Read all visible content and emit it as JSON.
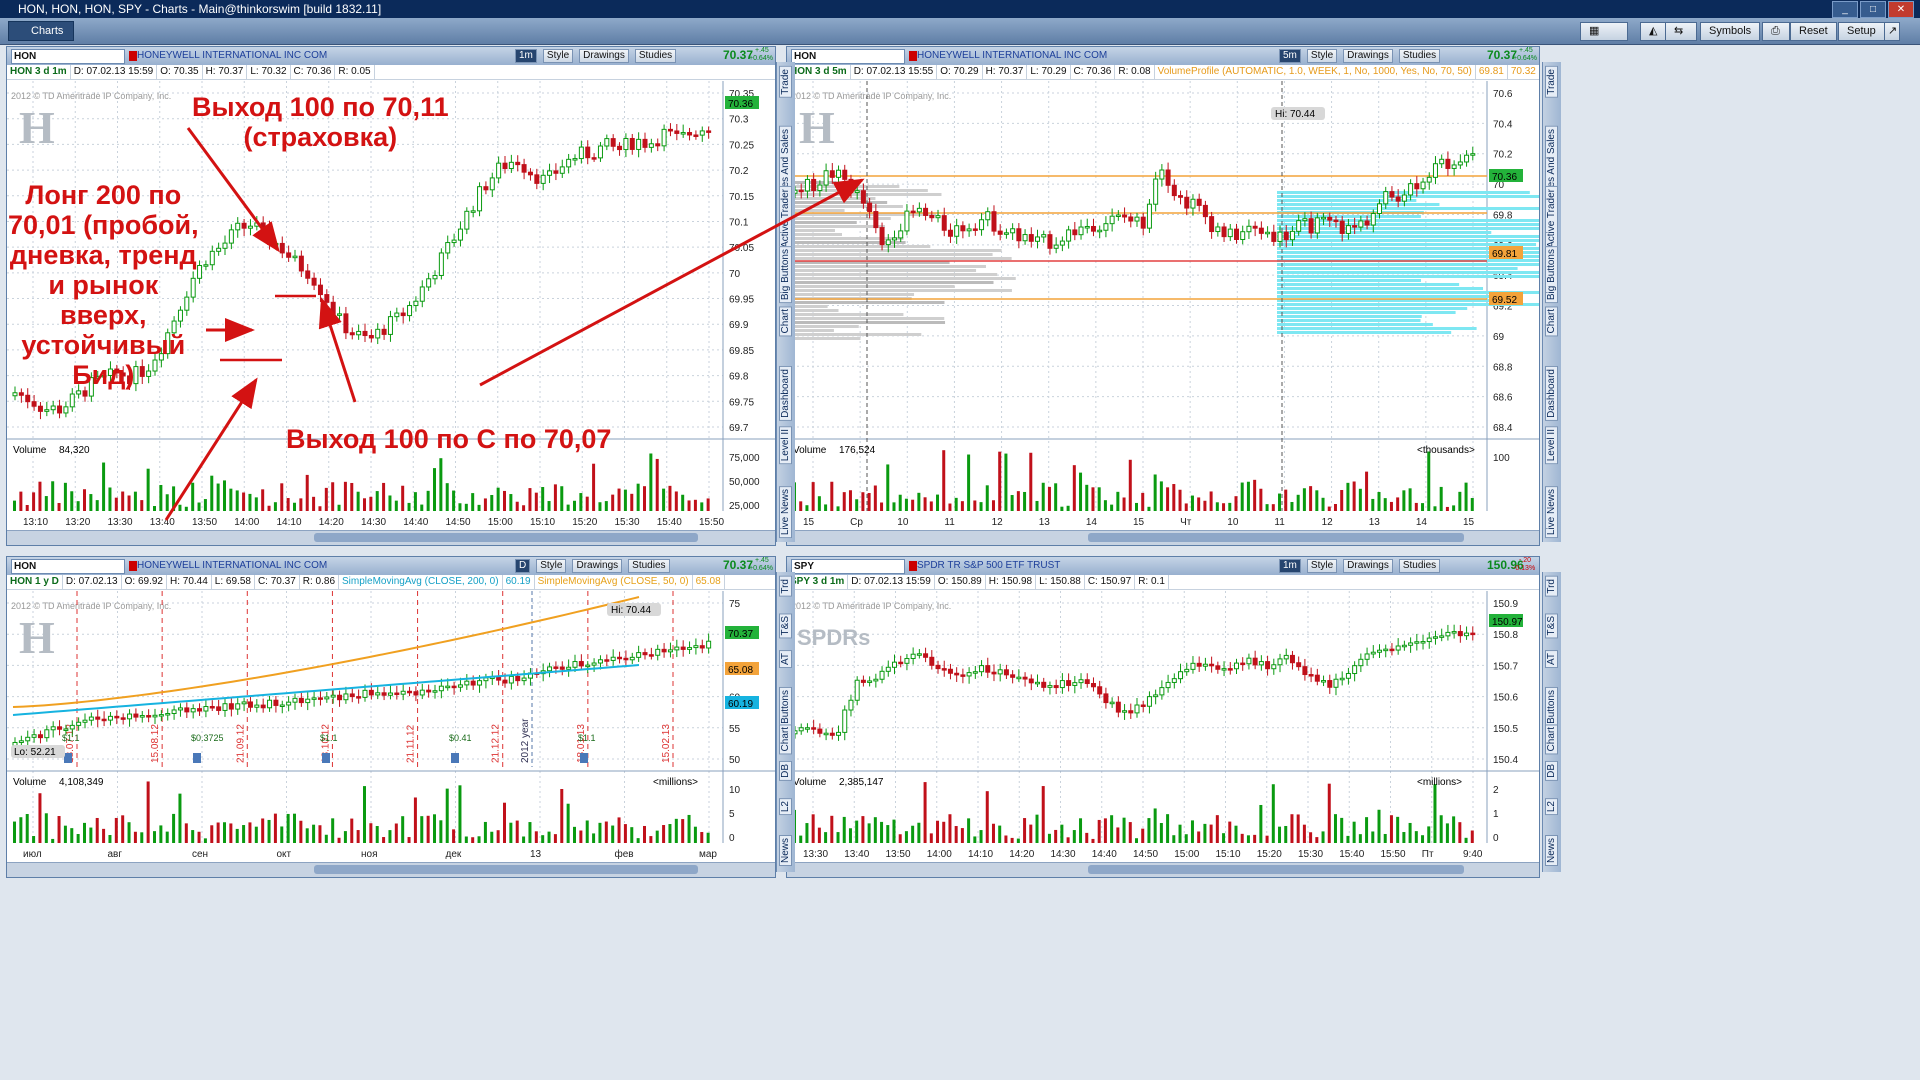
{
  "window": {
    "title": "HON, HON, HON, SPY - Charts -  Main@thinkorswim [build 1832.11]"
  },
  "toolbar": {
    "tab": "Charts",
    "symbols": "Symbols",
    "reset": "Reset",
    "setup": "Setup"
  },
  "sidebar_right": [
    "Trade",
    "Times And Sales",
    "Active Trader",
    "Big Buttons",
    "Chart",
    "Dashboard",
    "Level II",
    "Live News"
  ],
  "sidebar_right_small": [
    "Trd",
    "T&S",
    "AT",
    "Buttons",
    "Chart",
    "DB",
    "L2",
    "News"
  ],
  "panels": [
    {
      "symbol": "HON",
      "company": "HONEYWELL INTERNATIONAL INC COM",
      "interval": "1m",
      "last": "70.37",
      "change": "+.45",
      "change_pct": "+0.64%",
      "ohlc": [
        "HON 3 d 1m",
        "D: 07.02.13 15:59",
        "O: 70.35",
        "H: 70.37",
        "L: 70.32",
        "C: 70.36",
        "R: 0.05"
      ],
      "copyright": "2012 © TD Ameritrade IP Company, Inc.",
      "y_ticks": [
        "70.35",
        "70.3",
        "70.25",
        "70.2",
        "70.15",
        "70.1",
        "70.05",
        "70",
        "69.95",
        "69.9",
        "69.85",
        "69.8",
        "69.75",
        "69.7"
      ],
      "price_tag": "70.36",
      "volume": {
        "label": "Volume",
        "value": "84,320",
        "ticks": [
          "75,000",
          "50,000",
          "25,000"
        ]
      },
      "x_ticks": [
        "13:10",
        "13:20",
        "13:30",
        "13:40",
        "13:50",
        "14:00",
        "14:10",
        "14:20",
        "14:30",
        "14:40",
        "14:50",
        "15:00",
        "15:10",
        "15:20",
        "15:30",
        "15:40",
        "15:50"
      ],
      "annotations": {
        "exit1": "Выход 100 по 70,11\n(страховка)",
        "long": "Лонг 200 по\n70,01 (пробой,\nдневка, тренд\nи рынок\nвверх,\nустойчивый\nБид)",
        "exit2": "Выход 100 по С по 70,07"
      }
    },
    {
      "symbol": "HON",
      "company": "HONEYWELL INTERNATIONAL INC COM",
      "interval": "5m",
      "last": "70.37",
      "change": "+.45",
      "change_pct": "+0.64%",
      "ohlc": [
        "HON 3 d 5m",
        "D: 07.02.13 15:55",
        "O: 70.29",
        "H: 70.37",
        "L: 70.29",
        "C: 70.36",
        "R: 0.08"
      ],
      "study": "VolumeProfile (AUTOMATIC, 1.0, WEEK, 1, No, 1000, Yes, No, 70, 50)",
      "study_vals": [
        "69.81",
        "70.32",
        "69.52",
        "Vol..."
      ],
      "copyright": "2012 © TD Ameritrade IP Company, Inc.",
      "y_ticks": [
        "70.6",
        "70.4",
        "70.2",
        "70",
        "69.8",
        "69.6",
        "69.4",
        "69.2",
        "69",
        "68.8",
        "68.6",
        "68.4"
      ],
      "hi_label": "Hi: 70.44",
      "tags": [
        "70.36",
        "69.81",
        "69.52"
      ],
      "volume": {
        "label": "Volume",
        "value": "176,524",
        "unit": "<thousands>",
        "ticks": [
          "100"
        ]
      },
      "x_ticks": [
        "15",
        "Ср",
        "10",
        "11",
        "12",
        "13",
        "14",
        "15",
        "Чт",
        "10",
        "11",
        "12",
        "13",
        "14",
        "15"
      ]
    },
    {
      "symbol": "HON",
      "company": "HONEYWELL INTERNATIONAL INC COM",
      "interval": "D",
      "last": "70.37",
      "change": "+.45",
      "change_pct": "+0.64%",
      "ohlc": [
        "HON 1 y D",
        "D: 07.02.13",
        "O: 69.92",
        "H: 70.44",
        "L: 69.58",
        "C: 70.37",
        "R: 0.86"
      ],
      "study1": "SimpleMovingAvg (CLOSE, 200, 0)",
      "study1_val": "60.19",
      "study2": "SimpleMovingAvg (CLOSE, 50, 0)",
      "study2_val": "65.08",
      "copyright": "2012 © TD Ameritrade IP Company, Inc.",
      "y_ticks": [
        "75",
        "70",
        "65",
        "60",
        "55",
        "50"
      ],
      "hi_label": "Hi: 70.44",
      "lo_label": "Lo: 52.21",
      "tags": [
        "70.37",
        "65.08",
        "60.19"
      ],
      "events": [
        "18.07.12",
        "15.08.12",
        "21.09.12",
        "18.10.12",
        "21.11.12",
        "21.12.12",
        "18.01.13",
        "15.02.13"
      ],
      "dividends": [
        "$1.1",
        "$0.3725",
        "$1.1",
        "$0.41",
        "$1.1"
      ],
      "year_label": "2012 year",
      "volume": {
        "label": "Volume",
        "value": "4,108,349",
        "unit": "<millions>",
        "ticks": [
          "10",
          "5",
          "0"
        ]
      },
      "x_ticks": [
        "июл",
        "авг",
        "сен",
        "окт",
        "ноя",
        "дек",
        "13",
        "фев",
        "мар"
      ]
    },
    {
      "symbol": "SPY",
      "company": "SPDR TR S&P 500 ETF TRUST",
      "interval": "1m",
      "last": "150.96",
      "change": "-.20",
      "change_pct": "-0.13%",
      "ohlc": [
        "SPY 3 d 1m",
        "D: 07.02.13 15:59",
        "O: 150.89",
        "H: 150.98",
        "L: 150.88",
        "C: 150.97",
        "R: 0.1"
      ],
      "copyright": "2012 © TD Ameritrade IP Company, Inc.",
      "logo": "SPDRs",
      "y_ticks": [
        "150.9",
        "150.8",
        "150.7",
        "150.6",
        "150.5",
        "150.4"
      ],
      "price_tag": "150.97",
      "volume": {
        "label": "Volume",
        "value": "2,385,147",
        "unit": "<millions>",
        "ticks": [
          "2",
          "1",
          "0"
        ]
      },
      "x_ticks": [
        "13:30",
        "13:40",
        "13:50",
        "14:00",
        "14:10",
        "14:20",
        "14:30",
        "14:40",
        "14:50",
        "15:00",
        "15:10",
        "15:20",
        "15:30",
        "15:40",
        "15:50",
        "Пт",
        "9:40"
      ]
    }
  ],
  "tools": {
    "style": "Style",
    "drawings": "Drawings",
    "studies": "Studies"
  },
  "colors": {
    "up": "#0a9a10",
    "down": "#c0101a",
    "grid": "#c9d2dc",
    "annotation": "#d31212",
    "ma200": "#16b3e0",
    "ma50": "#f0a020"
  }
}
